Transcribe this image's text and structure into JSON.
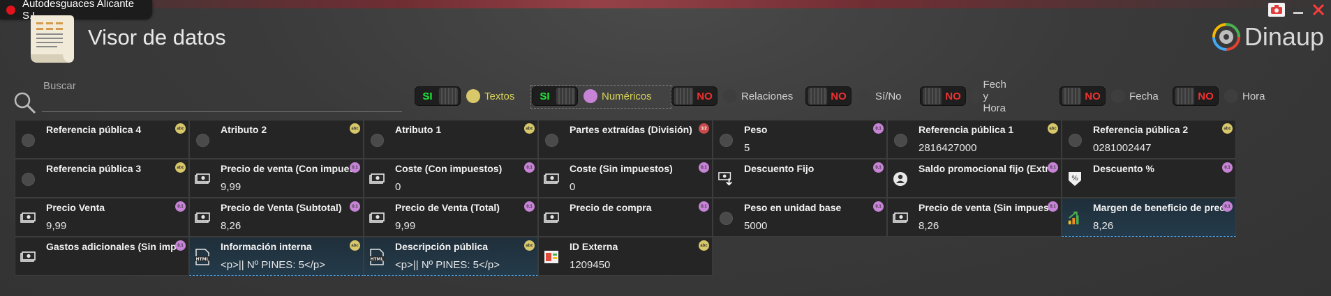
{
  "app": {
    "window_title": "Autodesguaces Alicante S.L"
  },
  "header": {
    "title": "Visor de datos",
    "brand": "Dinaup"
  },
  "search": {
    "label": "Buscar",
    "value": ""
  },
  "filters": [
    {
      "state": "SI",
      "label": "Textos",
      "on": true,
      "color": "#d7d35a"
    },
    {
      "state": "SI",
      "label": "Numéricos",
      "on": true,
      "color": "#d7d35a"
    },
    {
      "state": "NO",
      "label": "Relaciones",
      "on": false,
      "color": "#d0d0d0"
    },
    {
      "state": "NO",
      "label": "Sí/No",
      "on": false,
      "color": "#d0d0d0"
    },
    {
      "state": "NO",
      "label": "Fech y Hora",
      "on": false,
      "color": "#d0d0d0"
    },
    {
      "state": "NO",
      "label": "Fecha",
      "on": false,
      "color": "#d0d0d0"
    },
    {
      "state": "NO",
      "label": "Hora",
      "on": false,
      "color": "#d0d0d0"
    }
  ],
  "badges": {
    "txt": "abc",
    "num": "0.1",
    "rel": "1/2"
  },
  "cells": [
    {
      "title": "Referencia pública 4",
      "value": "",
      "badge": "txt",
      "icon": "circle-icon"
    },
    {
      "title": "Atributo 2",
      "value": "",
      "badge": "txt",
      "icon": "circle-icon"
    },
    {
      "title": "Atributo 1",
      "value": "",
      "badge": "txt",
      "icon": "circle-icon"
    },
    {
      "title": "Partes extraídas (División)",
      "value": "",
      "badge": "rel",
      "icon": "circle-icon"
    },
    {
      "title": "Peso",
      "value": "5",
      "badge": "num",
      "icon": "circle-icon"
    },
    {
      "title": "Referencia pública 1",
      "value": "2816427000",
      "badge": "txt",
      "icon": "circle-icon"
    },
    {
      "title": "Referencia pública 2",
      "value": "0281002447",
      "badge": "txt",
      "icon": "circle-icon"
    },
    {
      "title": "Referencia pública 3",
      "value": "",
      "badge": "txt",
      "icon": "circle-icon"
    },
    {
      "title": "Precio de venta (Con impuestos)",
      "value": "9,99",
      "badge": "num",
      "icon": "money-icon"
    },
    {
      "title": "Coste (Con impuestos)",
      "value": "0",
      "badge": "num",
      "icon": "money-icon"
    },
    {
      "title": "Coste (Sin impuestos)",
      "value": "0",
      "badge": "num",
      "icon": "money-icon"
    },
    {
      "title": "Descuento Fijo",
      "value": "",
      "badge": "num",
      "icon": "money-down-icon"
    },
    {
      "title": "Saldo promocional fijo (Extra)",
      "value": "",
      "badge": "num",
      "icon": "coin-person-icon"
    },
    {
      "title": "Descuento %",
      "value": "",
      "badge": "num",
      "icon": "percent-down-icon"
    },
    {
      "title": "Precio Venta",
      "value": "9,99",
      "badge": "num",
      "icon": "money-icon"
    },
    {
      "title": "Precio de Venta (Subtotal)",
      "value": "8,26",
      "badge": "num",
      "icon": "money-icon"
    },
    {
      "title": "Precio de Venta (Total)",
      "value": "9,99",
      "badge": "num",
      "icon": "money-icon"
    },
    {
      "title": "Precio de compra",
      "value": "",
      "badge": "num",
      "icon": "money-icon"
    },
    {
      "title": "Peso en unidad base",
      "value": "5000",
      "badge": "num",
      "icon": "circle-icon"
    },
    {
      "title": "Precio de venta (Sin impuestos)",
      "value": "8,26",
      "badge": "num",
      "icon": "money-icon"
    },
    {
      "title": "Margen de beneficio de precio",
      "value": "8,26",
      "badge": "num",
      "icon": "growth-chart-icon",
      "selected": true
    },
    {
      "title": "Gastos adicionales (Sin impuestos)",
      "value": "",
      "badge": "num",
      "icon": "money-icon"
    },
    {
      "title": "Información interna",
      "value": "<p>|| Nº PINES: 5</p>",
      "badge": "txt",
      "icon": "html-icon",
      "selected": true
    },
    {
      "title": "Descripción pública",
      "value": "<p>|| Nº PINES: 5</p>",
      "badge": "txt",
      "icon": "html-icon",
      "selected": true
    },
    {
      "title": "ID Externa",
      "value": "1209450",
      "badge": "txt",
      "icon": "id-card-icon"
    }
  ]
}
